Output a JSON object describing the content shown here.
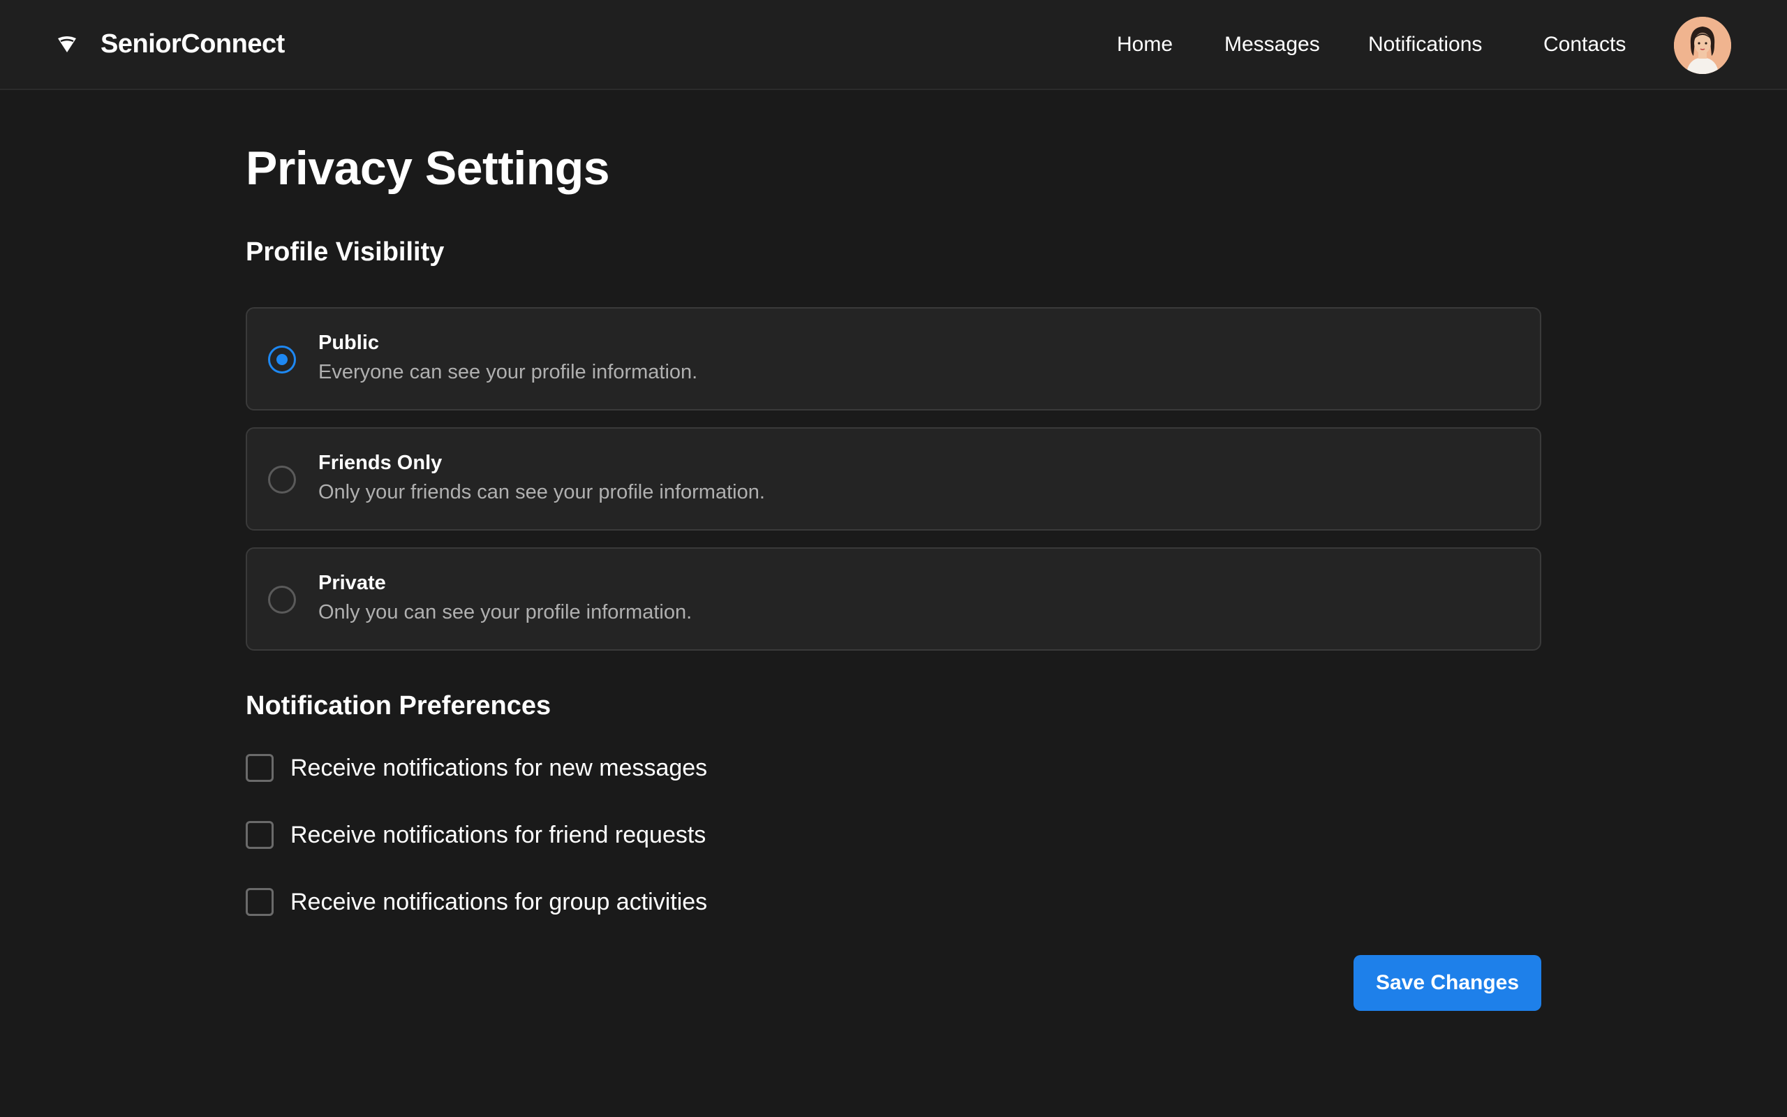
{
  "header": {
    "app_name": "SeniorConnect",
    "logo_icon": "brand-logo-icon",
    "nav": [
      {
        "label": "Home"
      },
      {
        "label": "Messages"
      },
      {
        "label": "Notifications"
      },
      {
        "label": "Contacts"
      }
    ],
    "avatar_icon": "user-avatar"
  },
  "main": {
    "title": "Privacy Settings",
    "profile_visibility": {
      "heading": "Profile Visibility",
      "selected": "Public",
      "options": [
        {
          "title": "Public",
          "description": "Everyone can see your profile information.",
          "checked": true
        },
        {
          "title": "Friends Only",
          "description": "Only your friends can see your profile information.",
          "checked": false
        },
        {
          "title": "Private",
          "description": "Only you can see your profile information.",
          "checked": false
        }
      ]
    },
    "notification_preferences": {
      "heading": "Notification Preferences",
      "items": [
        {
          "label": "Receive notifications for new messages",
          "checked": false
        },
        {
          "label": "Receive notifications for friend requests",
          "checked": false
        },
        {
          "label": "Receive notifications for group activities",
          "checked": false
        }
      ]
    },
    "save_label": "Save Changes"
  },
  "colors": {
    "background": "#1a1a1a",
    "header_bg": "#1f1f1f",
    "card_bg": "#242424",
    "accent": "#1e88f2",
    "muted_text": "#b0b0b0"
  }
}
